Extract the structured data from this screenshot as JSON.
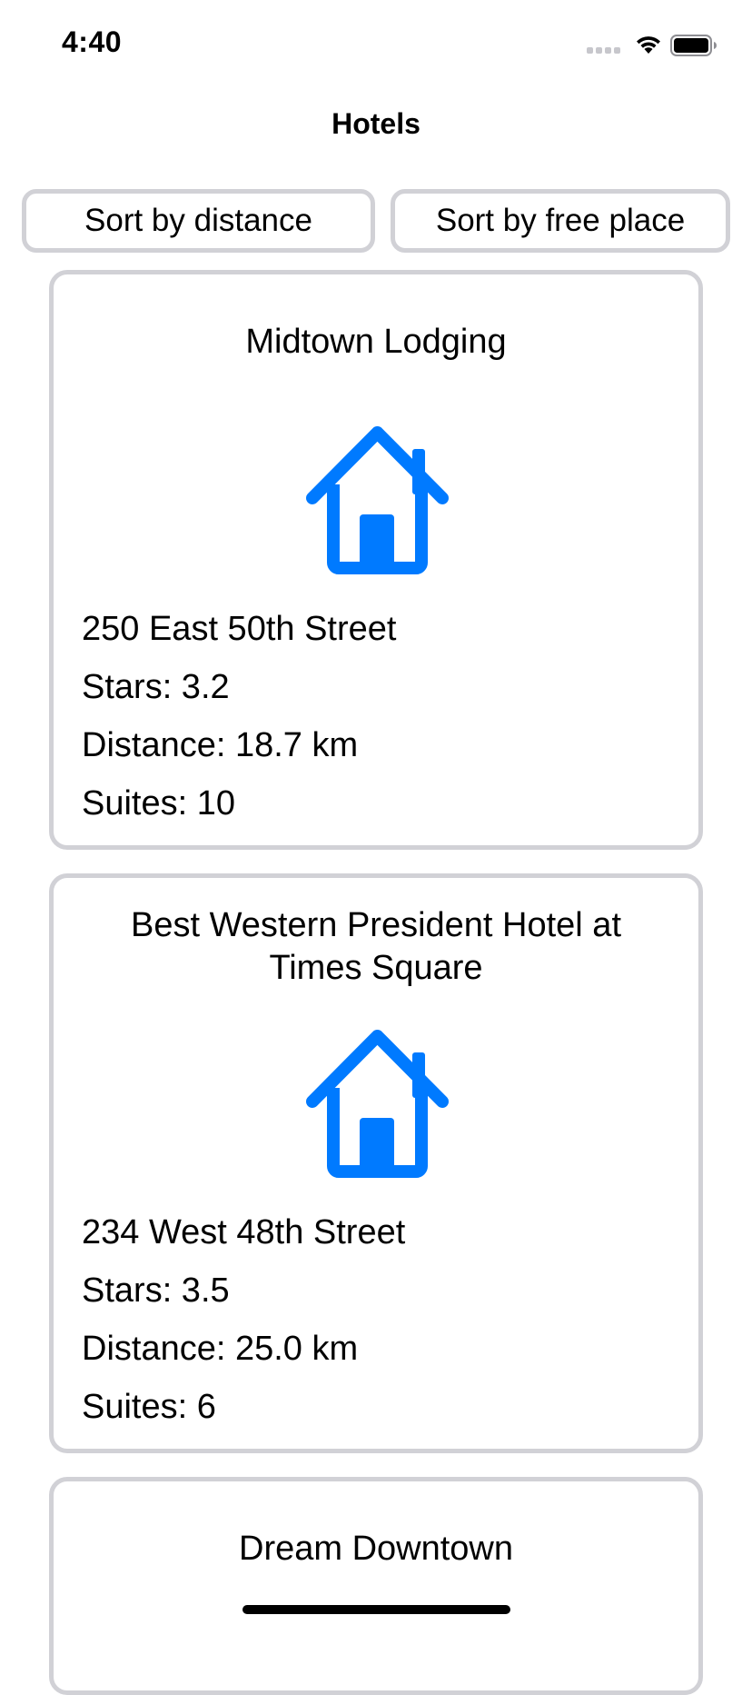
{
  "status_bar": {
    "time": "4:40",
    "icons": [
      "cellular-signal-icon",
      "wifi-icon",
      "battery-icon"
    ]
  },
  "nav": {
    "title": "Hotels"
  },
  "sort_buttons": {
    "distance_label": "Sort by distance",
    "free_place_label": "Sort by free place"
  },
  "hotels": [
    {
      "name": "Midtown Lodging",
      "icon": "house-icon",
      "address": "250 East 50th Street",
      "stars": "Stars: 3.2",
      "distance": "Distance: 18.7 km",
      "suites": "Suites: 10"
    },
    {
      "name": "Best Western President Hotel at Times Square",
      "icon": "house-icon",
      "address": "234 West 48th Street",
      "stars": "Stars: 3.5",
      "distance": "Distance: 25.0 km",
      "suites": "Suites: 6"
    },
    {
      "name": "Dream Downtown"
    }
  ],
  "colors": {
    "accent": "#007aff",
    "card_border": "#d1d1d6",
    "text": "#000000",
    "background": "#ffffff"
  }
}
